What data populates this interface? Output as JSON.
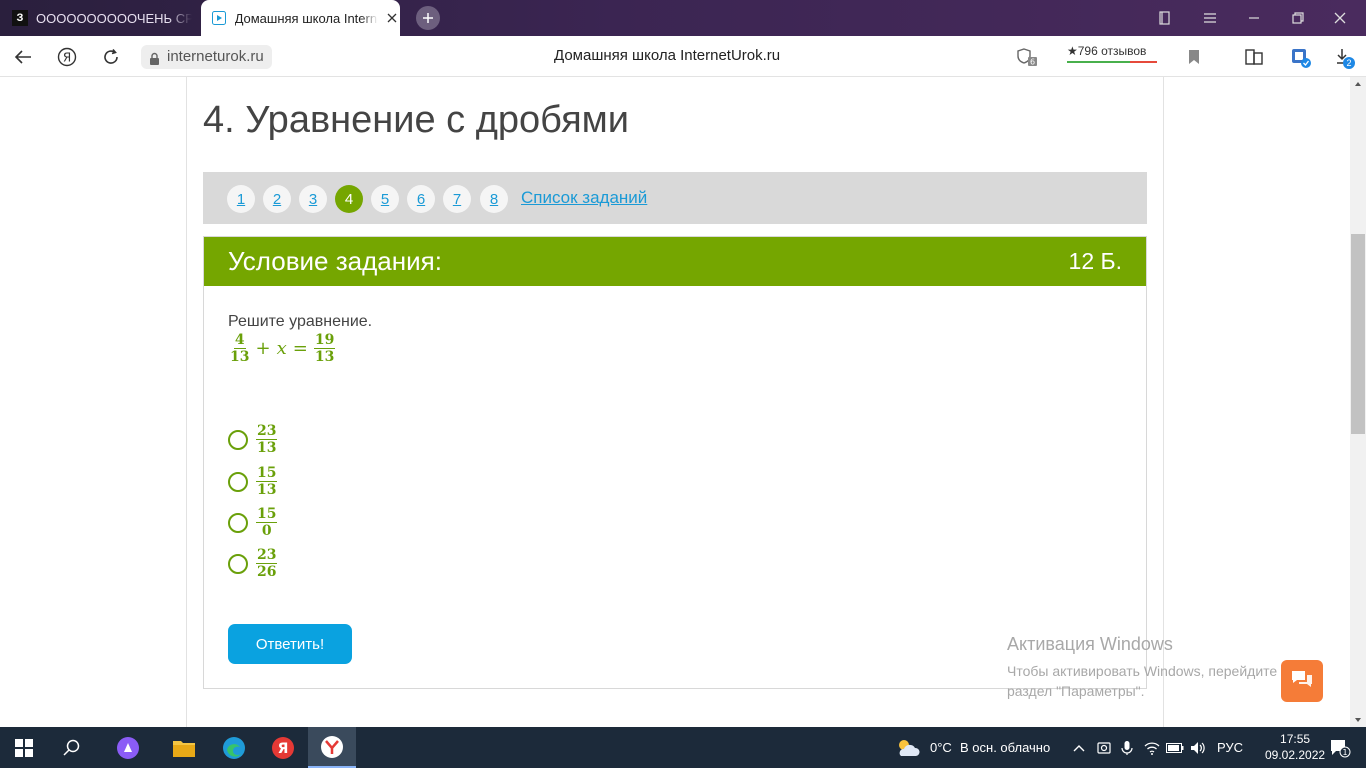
{
  "tabs": [
    {
      "favicon": "З",
      "title": "ООООООООООЧЕНЬ СРОЧНО"
    },
    {
      "title": "Домашняя школа InternetUrok.ru"
    }
  ],
  "address": {
    "url": "interneturok.ru",
    "title": "Домашняя школа InternetUrok.ru",
    "protect_count": "6",
    "reviews": "★796 отзывов",
    "downloads_count": "2"
  },
  "page": {
    "heading": "4. Уравнение с дробями",
    "pages": [
      "1",
      "2",
      "3",
      "4",
      "5",
      "6",
      "7",
      "8"
    ],
    "active_page": "4",
    "task_list_link": "Список заданий",
    "task": {
      "header": "Условие задания:",
      "points": "12 Б.",
      "prompt": "Решите уравнение.",
      "equation": {
        "a_num": "4",
        "a_den": "13",
        "op": "+",
        "var": "x",
        "eq": "=",
        "b_num": "19",
        "b_den": "13"
      },
      "options": [
        {
          "num": "23",
          "den": "13"
        },
        {
          "num": "15",
          "den": "13"
        },
        {
          "num": "15",
          "den": "0"
        },
        {
          "num": "23",
          "den": "26"
        }
      ],
      "submit": "Ответить!"
    }
  },
  "watermark": {
    "line1": "Активация Windows",
    "line2": "Чтобы активировать Windows, перейдите в",
    "line3": "раздел \"Параметры\"."
  },
  "taskbar": {
    "weather": "0°C",
    "weather_desc": "В осн. облачно",
    "lang": "РУС",
    "time": "17:55",
    "date": "09.02.2022",
    "notifications": "1"
  },
  "colors": {
    "accent_green": "#75a600",
    "link_blue": "#1a9ad6",
    "button_blue": "#0aa2e0",
    "chat_orange": "#f57c38"
  }
}
